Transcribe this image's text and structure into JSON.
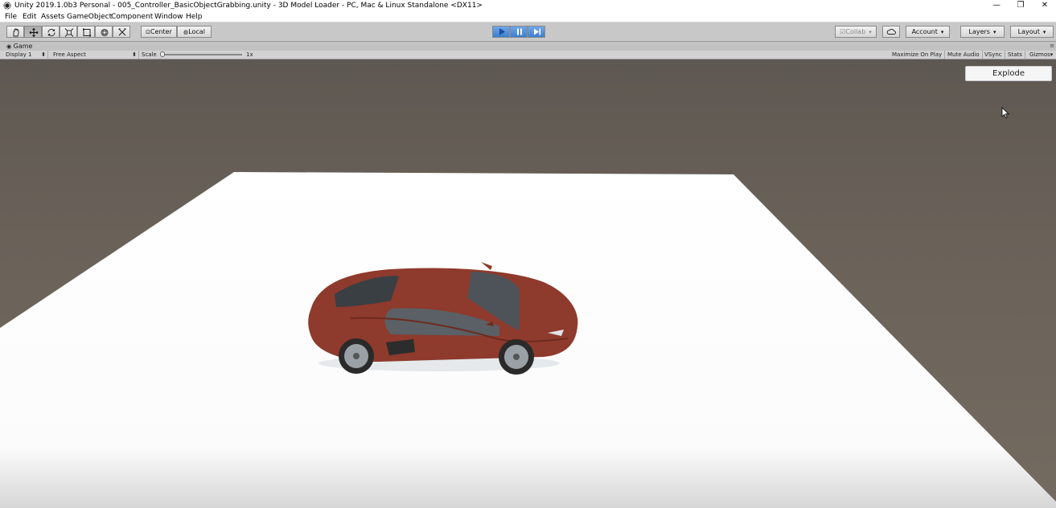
{
  "window": {
    "title": "Unity 2019.1.0b3 Personal - 005_Controller_BasicObjectGrabbing.unity - 3D Model Loader - PC, Mac & Linux Standalone <DX11>",
    "minimize_glyph": "—",
    "restore_glyph": "❐",
    "close_glyph": "✕"
  },
  "menu": {
    "items": [
      {
        "label": "File"
      },
      {
        "label": "Edit"
      },
      {
        "label": "Assets"
      },
      {
        "label": "GameObject"
      },
      {
        "label": "Component"
      },
      {
        "label": "Window"
      },
      {
        "label": "Help"
      }
    ]
  },
  "toolbar": {
    "tools": [
      {
        "name": "hand-tool",
        "icon": "hand-icon"
      },
      {
        "name": "move-tool",
        "icon": "move-icon",
        "active": true
      },
      {
        "name": "rotate-tool",
        "icon": "rotate-icon"
      },
      {
        "name": "scale-tool",
        "icon": "scale-icon"
      },
      {
        "name": "rect-tool",
        "icon": "rect-icon"
      },
      {
        "name": "transform-tool",
        "icon": "transform-icon"
      },
      {
        "name": "custom-tool",
        "icon": "custom-tool-icon"
      }
    ],
    "pivot_label": "Center",
    "pivot_space_label": "Local",
    "collab_label": "Collab",
    "account_label": "Account",
    "layers_label": "Layers",
    "layout_label": "Layout",
    "play_state": {
      "playing": true,
      "paused": true
    },
    "accent_color": "#3b7fd1"
  },
  "game_tab": {
    "label": "Game",
    "display_label": "Display 1",
    "aspect_label": "Free Aspect",
    "scale_label": "Scale",
    "scale_value": "1x",
    "maximize_label": "Maximize On Play",
    "mute_label": "Mute Audio",
    "vsync_label": "VSync",
    "stats_label": "Stats",
    "gizmos_label": "Gizmos"
  },
  "scene": {
    "explode_button_label": "Explode",
    "car_color": "#8e3a2c",
    "ground_color": "#ffffff",
    "sky_color": "#6a6259"
  }
}
